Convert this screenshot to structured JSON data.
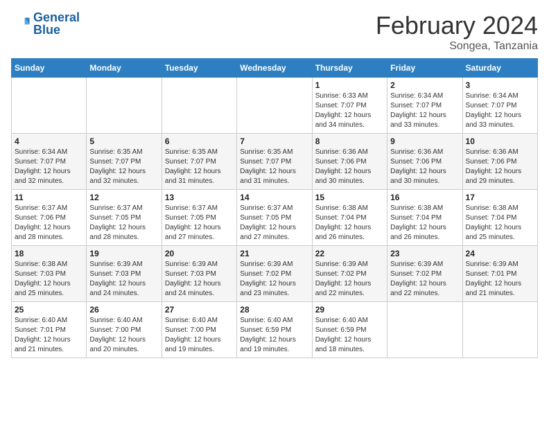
{
  "header": {
    "logo_line1": "General",
    "logo_line2": "Blue",
    "month_title": "February 2024",
    "location": "Songea, Tanzania"
  },
  "days_of_week": [
    "Sunday",
    "Monday",
    "Tuesday",
    "Wednesday",
    "Thursday",
    "Friday",
    "Saturday"
  ],
  "weeks": [
    [
      {
        "day": "",
        "info": ""
      },
      {
        "day": "",
        "info": ""
      },
      {
        "day": "",
        "info": ""
      },
      {
        "day": "",
        "info": ""
      },
      {
        "day": "1",
        "info": "Sunrise: 6:33 AM\nSunset: 7:07 PM\nDaylight: 12 hours\nand 34 minutes."
      },
      {
        "day": "2",
        "info": "Sunrise: 6:34 AM\nSunset: 7:07 PM\nDaylight: 12 hours\nand 33 minutes."
      },
      {
        "day": "3",
        "info": "Sunrise: 6:34 AM\nSunset: 7:07 PM\nDaylight: 12 hours\nand 33 minutes."
      }
    ],
    [
      {
        "day": "4",
        "info": "Sunrise: 6:34 AM\nSunset: 7:07 PM\nDaylight: 12 hours\nand 32 minutes."
      },
      {
        "day": "5",
        "info": "Sunrise: 6:35 AM\nSunset: 7:07 PM\nDaylight: 12 hours\nand 32 minutes."
      },
      {
        "day": "6",
        "info": "Sunrise: 6:35 AM\nSunset: 7:07 PM\nDaylight: 12 hours\nand 31 minutes."
      },
      {
        "day": "7",
        "info": "Sunrise: 6:35 AM\nSunset: 7:07 PM\nDaylight: 12 hours\nand 31 minutes."
      },
      {
        "day": "8",
        "info": "Sunrise: 6:36 AM\nSunset: 7:06 PM\nDaylight: 12 hours\nand 30 minutes."
      },
      {
        "day": "9",
        "info": "Sunrise: 6:36 AM\nSunset: 7:06 PM\nDaylight: 12 hours\nand 30 minutes."
      },
      {
        "day": "10",
        "info": "Sunrise: 6:36 AM\nSunset: 7:06 PM\nDaylight: 12 hours\nand 29 minutes."
      }
    ],
    [
      {
        "day": "11",
        "info": "Sunrise: 6:37 AM\nSunset: 7:06 PM\nDaylight: 12 hours\nand 28 minutes."
      },
      {
        "day": "12",
        "info": "Sunrise: 6:37 AM\nSunset: 7:05 PM\nDaylight: 12 hours\nand 28 minutes."
      },
      {
        "day": "13",
        "info": "Sunrise: 6:37 AM\nSunset: 7:05 PM\nDaylight: 12 hours\nand 27 minutes."
      },
      {
        "day": "14",
        "info": "Sunrise: 6:37 AM\nSunset: 7:05 PM\nDaylight: 12 hours\nand 27 minutes."
      },
      {
        "day": "15",
        "info": "Sunrise: 6:38 AM\nSunset: 7:04 PM\nDaylight: 12 hours\nand 26 minutes."
      },
      {
        "day": "16",
        "info": "Sunrise: 6:38 AM\nSunset: 7:04 PM\nDaylight: 12 hours\nand 26 minutes."
      },
      {
        "day": "17",
        "info": "Sunrise: 6:38 AM\nSunset: 7:04 PM\nDaylight: 12 hours\nand 25 minutes."
      }
    ],
    [
      {
        "day": "18",
        "info": "Sunrise: 6:38 AM\nSunset: 7:03 PM\nDaylight: 12 hours\nand 25 minutes."
      },
      {
        "day": "19",
        "info": "Sunrise: 6:39 AM\nSunset: 7:03 PM\nDaylight: 12 hours\nand 24 minutes."
      },
      {
        "day": "20",
        "info": "Sunrise: 6:39 AM\nSunset: 7:03 PM\nDaylight: 12 hours\nand 24 minutes."
      },
      {
        "day": "21",
        "info": "Sunrise: 6:39 AM\nSunset: 7:02 PM\nDaylight: 12 hours\nand 23 minutes."
      },
      {
        "day": "22",
        "info": "Sunrise: 6:39 AM\nSunset: 7:02 PM\nDaylight: 12 hours\nand 22 minutes."
      },
      {
        "day": "23",
        "info": "Sunrise: 6:39 AM\nSunset: 7:02 PM\nDaylight: 12 hours\nand 22 minutes."
      },
      {
        "day": "24",
        "info": "Sunrise: 6:39 AM\nSunset: 7:01 PM\nDaylight: 12 hours\nand 21 minutes."
      }
    ],
    [
      {
        "day": "25",
        "info": "Sunrise: 6:40 AM\nSunset: 7:01 PM\nDaylight: 12 hours\nand 21 minutes."
      },
      {
        "day": "26",
        "info": "Sunrise: 6:40 AM\nSunset: 7:00 PM\nDaylight: 12 hours\nand 20 minutes."
      },
      {
        "day": "27",
        "info": "Sunrise: 6:40 AM\nSunset: 7:00 PM\nDaylight: 12 hours\nand 19 minutes."
      },
      {
        "day": "28",
        "info": "Sunrise: 6:40 AM\nSunset: 6:59 PM\nDaylight: 12 hours\nand 19 minutes."
      },
      {
        "day": "29",
        "info": "Sunrise: 6:40 AM\nSunset: 6:59 PM\nDaylight: 12 hours\nand 18 minutes."
      },
      {
        "day": "",
        "info": ""
      },
      {
        "day": "",
        "info": ""
      }
    ]
  ]
}
